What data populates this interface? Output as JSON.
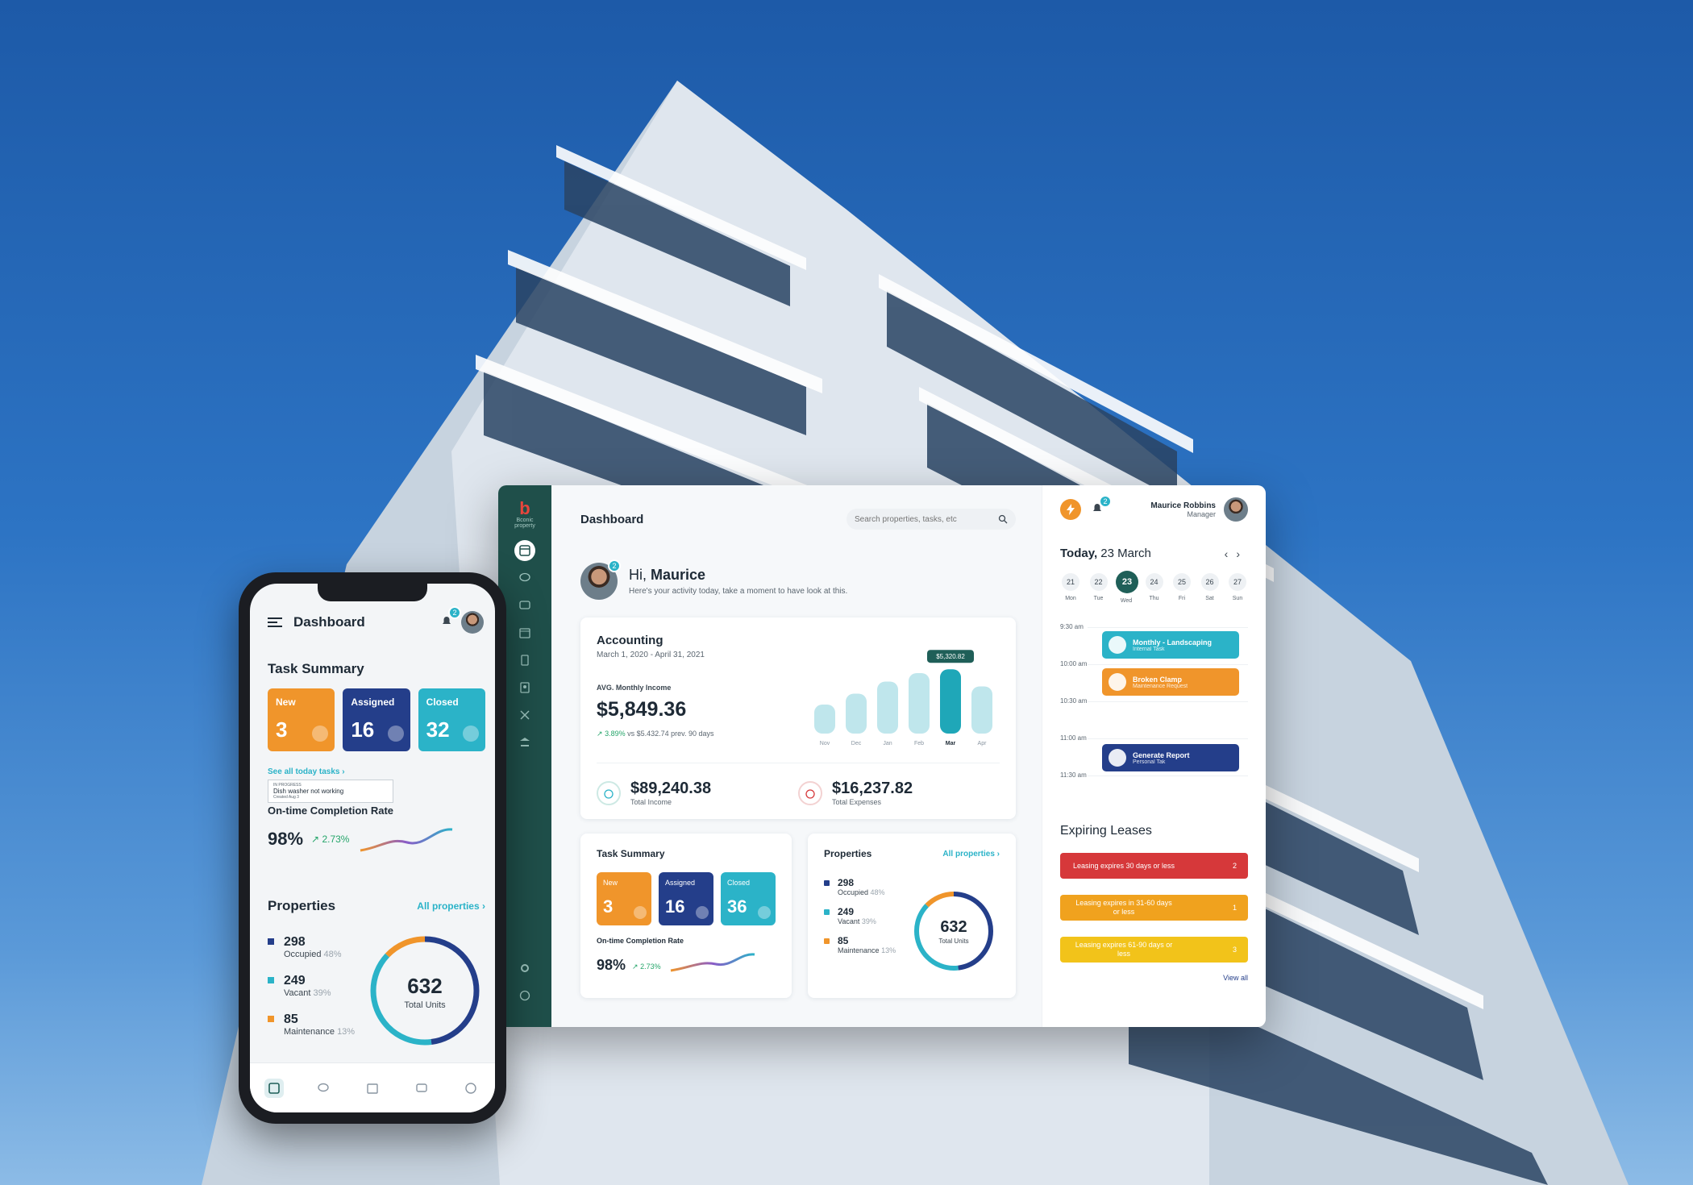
{
  "desktop": {
    "logo_text": "Bconic property",
    "title": "Dashboard",
    "search": {
      "placeholder": "Search properties, tasks, etc"
    },
    "greeting": {
      "hi": "Hi,",
      "name": "Maurice",
      "subtitle": "Here's your activity today, take a moment to have look at this.",
      "badge": "2"
    },
    "accounting": {
      "title": "Accounting",
      "range": "March 1, 2020 - April 31, 2021",
      "avg_label": "AVG. Monthly Income",
      "avg_value": "$5,849.36",
      "change_pct": "3.89%",
      "change_text": "vs $5.432.74 prev. 90 days",
      "tooltip": "$5,320.82",
      "total_income": "$89,240.38",
      "total_income_label": "Total Income",
      "total_expenses": "$16,237.82",
      "total_expenses_label": "Total Expenses"
    },
    "task_summary": {
      "title": "Task Summary",
      "tiles": [
        {
          "label": "New",
          "value": "3"
        },
        {
          "label": "Assigned",
          "value": "16"
        },
        {
          "label": "Closed",
          "value": "36"
        }
      ],
      "completion_label": "On-time Completion Rate",
      "completion_value": "98%",
      "completion_delta": "2.73%"
    },
    "properties": {
      "title": "Properties",
      "all_link": "All properties",
      "items": [
        {
          "value": "298",
          "label": "Occupied",
          "pct": "48%"
        },
        {
          "value": "249",
          "label": "Vacant",
          "pct": "39%"
        },
        {
          "value": "85",
          "label": "Maintenance",
          "pct": "13%"
        }
      ],
      "total": "632",
      "total_label": "Total Units"
    },
    "user": {
      "name": "Maurice Robbins",
      "role": "Manager",
      "notif_badge": "2"
    },
    "calendar": {
      "today_prefix": "Today,",
      "today_date": "23 March",
      "days": [
        {
          "n": "21",
          "w": "Mon"
        },
        {
          "n": "22",
          "w": "Tue"
        },
        {
          "n": "23",
          "w": "Wed"
        },
        {
          "n": "24",
          "w": "Thu"
        },
        {
          "n": "25",
          "w": "Fri"
        },
        {
          "n": "26",
          "w": "Sat"
        },
        {
          "n": "27",
          "w": "Sun"
        }
      ],
      "times": [
        "9:30 am",
        "10:00 am",
        "10:30 am",
        "11:00 am",
        "11:30 am"
      ],
      "events": [
        {
          "title": "Monthly - Landscaping",
          "sub": "Internal Task"
        },
        {
          "title": "Broken Clamp",
          "sub": "Maintenance Request"
        },
        {
          "title": "Generate Report",
          "sub": "Personal Tak"
        }
      ]
    },
    "leases": {
      "title": "Expiring Leases",
      "items": [
        {
          "text": "Leasing expires 30 days or less",
          "count": "2"
        },
        {
          "text": "Leasing expires in 31-60 days or less",
          "count": "1"
        },
        {
          "text": "Leasing expires 61-90 days or less",
          "count": "3"
        }
      ],
      "view_all": "View all"
    }
  },
  "phone": {
    "title": "Dashboard",
    "notif_badge": "2",
    "task_summary": {
      "title": "Task Summary",
      "tiles": [
        {
          "label": "New",
          "value": "3"
        },
        {
          "label": "Assigned",
          "value": "16"
        },
        {
          "label": "Closed",
          "value": "32"
        }
      ],
      "see_all": "See all today tasks",
      "tip_status": "IN PROGRESS",
      "tip_title": "Dish washer not working",
      "tip_date": "Created Aug 3",
      "completion_label": "On-time Completion Rate",
      "completion_value": "98%",
      "completion_delta": "2.73%"
    },
    "properties": {
      "title": "Properties",
      "all_link": "All properties",
      "items": [
        {
          "value": "298",
          "label": "Occupied",
          "pct": "48%"
        },
        {
          "value": "249",
          "label": "Vacant",
          "pct": "39%"
        },
        {
          "value": "85",
          "label": "Maintenance",
          "pct": "13%"
        }
      ],
      "total": "632",
      "total_label": "Total Units"
    }
  },
  "chart_data": {
    "type": "bar",
    "categories": [
      "Nov",
      "Dec",
      "Jan",
      "Feb",
      "Mar",
      "Apr"
    ],
    "values": [
      2400,
      3300,
      4300,
      5000,
      5320.82,
      3900
    ],
    "highlight": "Mar",
    "title": "",
    "xlabel": "",
    "ylabel": ""
  },
  "colors": {
    "teal": "#2bb3c8",
    "navy": "#243e8a",
    "orange": "#f0952b",
    "rail": "#1f4f4a",
    "red": "#d6383a",
    "amber": "#f0a21e",
    "yellow": "#f2c31a"
  }
}
